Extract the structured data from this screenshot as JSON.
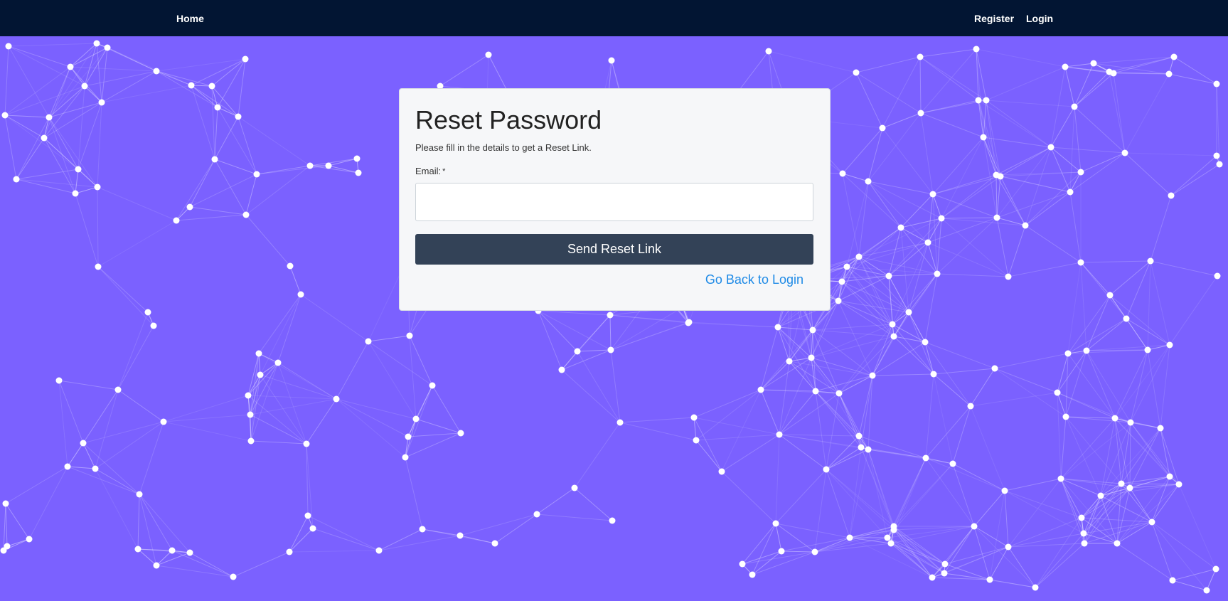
{
  "navbar": {
    "home_label": "Home",
    "register_label": "Register",
    "login_label": "Login"
  },
  "reset_form": {
    "title": "Reset Password",
    "subtitle": "Please fill in the details to get a Reset Link.",
    "email_label": "Email:",
    "required_marker": "*",
    "email_value": "",
    "email_placeholder": "",
    "submit_label": "Send Reset Link",
    "back_link_label": "Go Back to Login"
  },
  "colors": {
    "background": "#7b61ff",
    "navbar": "#021533",
    "card": "#f6f7f9",
    "button": "#334257",
    "link": "#1e8ae6",
    "network_node": "#ffffff"
  }
}
